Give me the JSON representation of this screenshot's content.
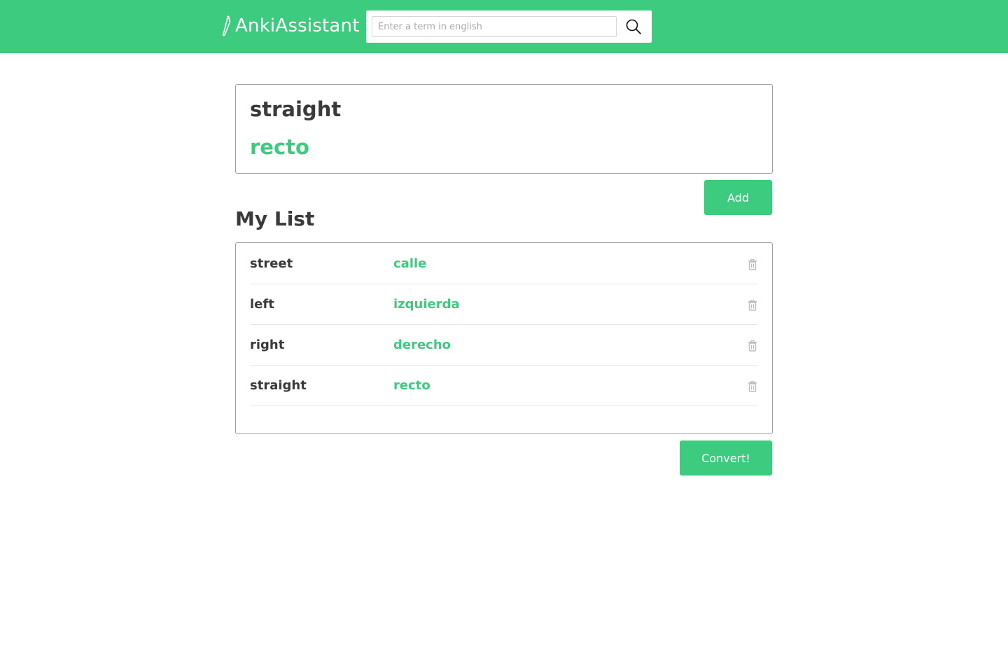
{
  "app": {
    "title": "AnkiAssistant"
  },
  "colors": {
    "accent": "#3dcb7f",
    "text": "#3a3a3a",
    "white": "#ffffff"
  },
  "search": {
    "placeholder": "Enter a term in english",
    "value": "",
    "icon": "search-icon"
  },
  "result": {
    "term": "straight",
    "translation": "recto"
  },
  "actions": {
    "add_label": "Add",
    "convert_label": "Convert!"
  },
  "list": {
    "title": "My List",
    "items": [
      {
        "word": "street",
        "translation": "calle",
        "icon": "trash-icon"
      },
      {
        "word": "left",
        "translation": "izquierda",
        "icon": "trash-icon"
      },
      {
        "word": "right",
        "translation": "derecho",
        "icon": "trash-icon"
      },
      {
        "word": "straight",
        "translation": "recto",
        "icon": "trash-icon"
      }
    ]
  }
}
